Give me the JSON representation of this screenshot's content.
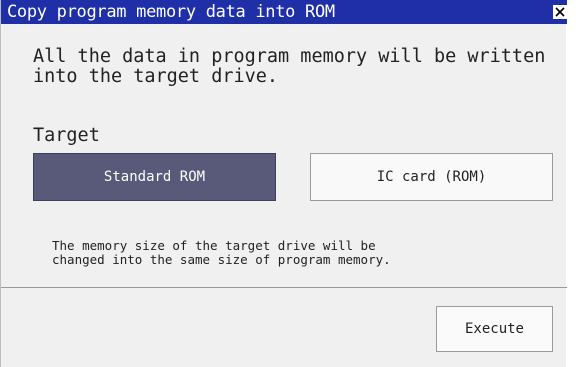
{
  "dialog": {
    "title": "Copy program memory data into ROM",
    "close_icon": "close-icon",
    "message": "All the data in program memory will be written\ninto the target drive.",
    "target_label": "Target",
    "targets": [
      {
        "label": "Standard ROM",
        "selected": true
      },
      {
        "label": "IC card (ROM)",
        "selected": false
      }
    ],
    "note": "The memory size of the target drive will be\nchanged into the same size of program memory.",
    "execute_label": "Execute"
  },
  "colors": {
    "titlebar": "#1f2fa8",
    "selected_button": "#59597a",
    "dialog_background": "#f0f0f0"
  }
}
